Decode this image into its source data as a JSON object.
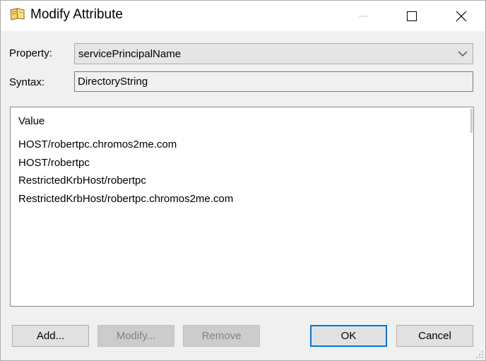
{
  "window": {
    "title": "Modify Attribute"
  },
  "form": {
    "property_label": "Property:",
    "property_value": "servicePrincipalName",
    "syntax_label": "Syntax:",
    "syntax_value": "DirectoryString"
  },
  "values_list": {
    "header": "Value",
    "items": [
      "HOST/robertpc.chromos2me.com",
      "HOST/robertpc",
      "RestrictedKrbHost/robertpc",
      "RestrictedKrbHost/robertpc.chromos2me.com"
    ]
  },
  "buttons": {
    "add": "Add...",
    "modify": "Modify...",
    "remove": "Remove",
    "ok": "OK",
    "cancel": "Cancel"
  },
  "icons": {
    "title": "open-book-icon",
    "minimize": "minimize-icon",
    "maximize": "maximize-icon",
    "close": "close-icon",
    "dropdown": "chevron-down-icon",
    "resize": "resize-grip-icon"
  },
  "colors": {
    "focus_border": "#0078d7",
    "dialog_bg": "#f0f0f0",
    "disabled_text": "#838383"
  }
}
